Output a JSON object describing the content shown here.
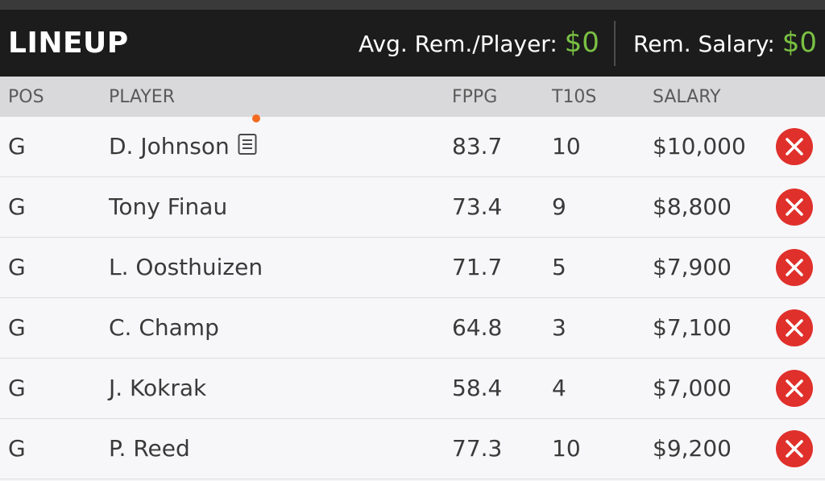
{
  "header": {
    "title": "LINEUP",
    "avg_label": "Avg. Rem./Player:",
    "avg_value": "$0",
    "rem_label": "Rem. Salary:",
    "rem_value": "$0"
  },
  "columns": {
    "pos": "POS",
    "player": "PLAYER",
    "fppg": "FPPG",
    "t10s": "T10S",
    "salary": "SALARY"
  },
  "rows": [
    {
      "pos": "G",
      "player": "D. Johnson",
      "fppg": "83.7",
      "t10s": "10",
      "salary": "$10,000",
      "has_news": true
    },
    {
      "pos": "G",
      "player": "Tony Finau",
      "fppg": "73.4",
      "t10s": "9",
      "salary": "$8,800"
    },
    {
      "pos": "G",
      "player": "L. Oosthuizen",
      "fppg": "71.7",
      "t10s": "5",
      "salary": "$7,900"
    },
    {
      "pos": "G",
      "player": "C. Champ",
      "fppg": "64.8",
      "t10s": "3",
      "salary": "$7,100"
    },
    {
      "pos": "G",
      "player": "J. Kokrak",
      "fppg": "58.4",
      "t10s": "4",
      "salary": "$7,000"
    },
    {
      "pos": "G",
      "player": "P. Reed",
      "fppg": "77.3",
      "t10s": "10",
      "salary": "$9,200"
    }
  ],
  "icons": {
    "remove": "remove-x-circle-icon",
    "news": "player-news-icon"
  },
  "colors": {
    "accent_green": "#7ac143",
    "remove_red": "#e0302b",
    "news_dot": "#f36b21"
  }
}
